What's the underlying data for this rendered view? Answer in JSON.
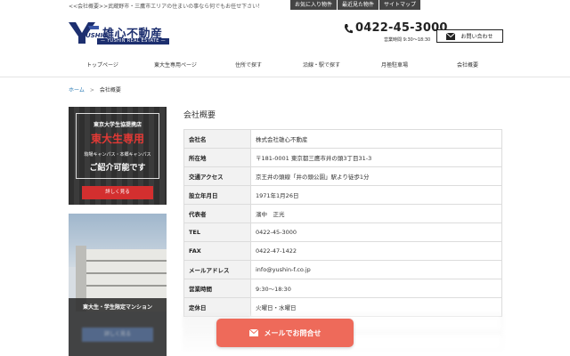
{
  "header": {
    "tagline": "<<会社概要>>武蔵野市・三鷹市エリアの住まいの事なら何でもお任せ下さい！",
    "top_links": [
      {
        "label": "お気に入り物件"
      },
      {
        "label": "最近見た物件"
      },
      {
        "label": "サイトマップ"
      }
    ],
    "logo": {
      "brand": "雄心不動産",
      "mark_text": "YUSHIN",
      "sub": "— YUSHIN REAL ESTATE —"
    },
    "phone": "0422-45-3000",
    "hours": "営業時間 9:30〜18:30",
    "contact_label": "お問い合わせ",
    "colors": {
      "brand_navy": "#1d2f6f",
      "accent_red": "#d32f2f",
      "cta_coral": "#ee6a5a"
    }
  },
  "nav": {
    "items": [
      {
        "label": "トップページ"
      },
      {
        "label": "東大生専用ページ"
      },
      {
        "label": "住所で探す"
      },
      {
        "label": "沿線・駅で探す"
      },
      {
        "label": "月極駐車場"
      },
      {
        "label": "会社概要"
      }
    ]
  },
  "breadcrumb": {
    "home": "ホーム",
    "sep": ">",
    "current": "会社概要"
  },
  "sidebar": {
    "banner1": {
      "line1": "東京大学生協提携店",
      "line2": "東大生専用",
      "line3": "駒場キャンパス・本郷キャンパス",
      "line4": "ご紹介可能です",
      "button": "詳しく見る"
    },
    "banner2": {
      "caption": "東大生・学生限定マンション",
      "button": "詳しく見る"
    }
  },
  "main": {
    "title": "会社概要",
    "rows": [
      {
        "label": "会社名",
        "value": "株式会社雄心不動産"
      },
      {
        "label": "所在地",
        "value": "〒181-0001 東京都三鷹市井の頭3丁目31-3"
      },
      {
        "label": "交通アクセス",
        "value": "京王井の頭線「井の頭公園」駅より徒歩1分"
      },
      {
        "label": "設立年月日",
        "value": "1971年1月26日"
      },
      {
        "label": "代表者",
        "value": "濱中　正光"
      },
      {
        "label": "TEL",
        "value": "0422-45-3000"
      },
      {
        "label": "FAX",
        "value": "0422-47-1422"
      },
      {
        "label": "メールアドレス",
        "value": "info@yushin-f.co.jp"
      },
      {
        "label": "営業時間",
        "value": "9:30〜18:30"
      },
      {
        "label": "定休日",
        "value": "火曜日・水曜日"
      }
    ]
  },
  "floating_cta": {
    "label": "メールでお問合せ",
    "icon": "mail-icon"
  }
}
